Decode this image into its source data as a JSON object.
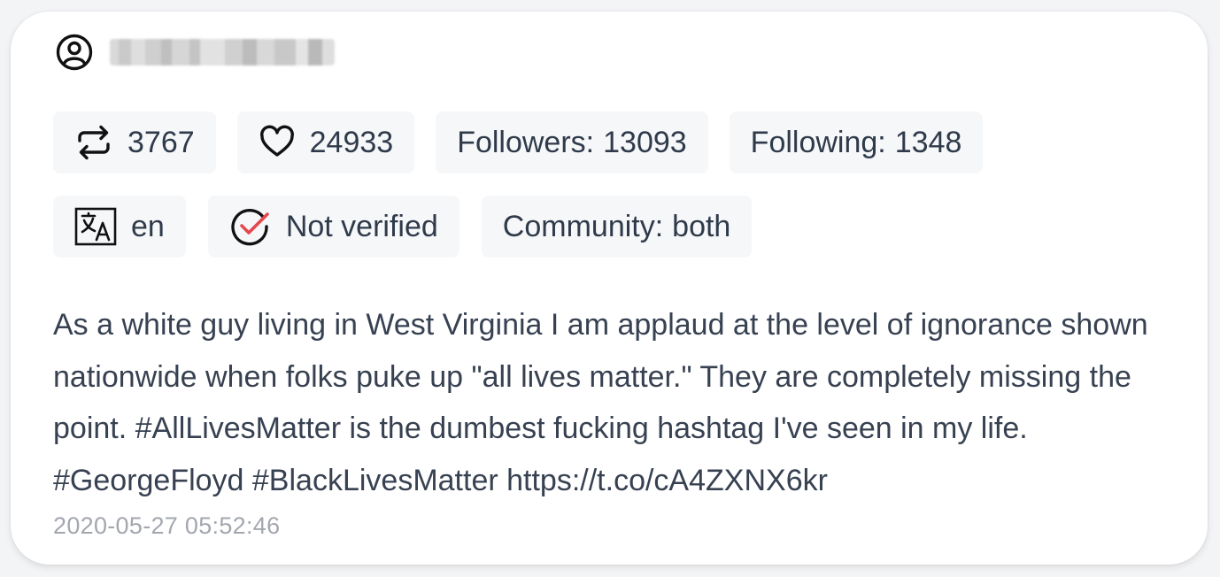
{
  "user": {
    "icon": "user-circle-icon",
    "name_blurred": true
  },
  "stats": {
    "retweets": {
      "icon": "retweet-icon",
      "value": "3767"
    },
    "likes": {
      "icon": "heart-icon",
      "value": "24933"
    },
    "followers": {
      "label": "Followers:",
      "value": "13093"
    },
    "following": {
      "label": "Following:",
      "value": "1348"
    }
  },
  "meta": {
    "language": {
      "icon": "translate-icon",
      "value": "en"
    },
    "verification": {
      "icon": "check-circle-icon",
      "value": "Not verified",
      "accent": "#e5484d"
    },
    "community": {
      "label": "Community:",
      "value": "both"
    }
  },
  "tweet": {
    "text": "As a white guy living in West Virginia I am applaud at the level of ignorance shown nationwide when folks puke up \"all lives matter.\" They are completely missing the point. #AllLivesMatter is the dumbest fucking hashtag I've seen in my life. #GeorgeFloyd #BlackLivesMatter https://t.co/cA4ZXNX6kr",
    "timestamp": "2020-05-27 05:52:46"
  },
  "colors": {
    "card_bg": "#ffffff",
    "chip_bg": "#f6f7f9",
    "text": "#2f3a4a",
    "muted": "#a3a7ae"
  }
}
